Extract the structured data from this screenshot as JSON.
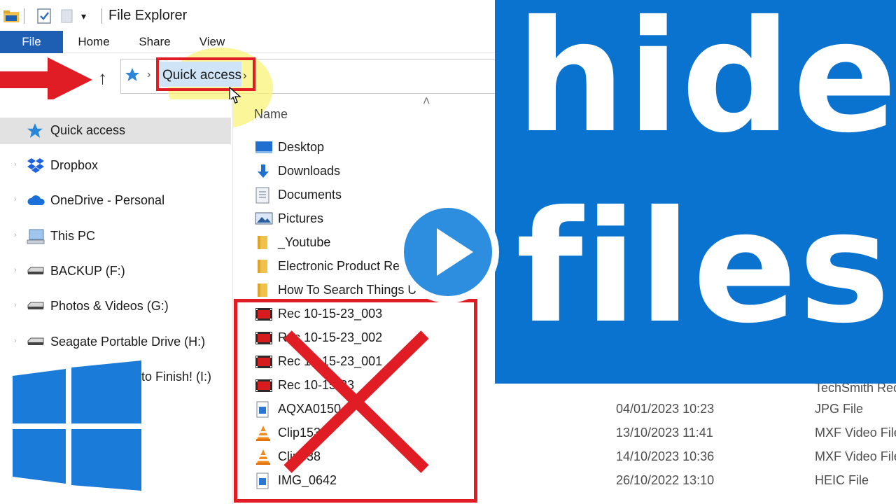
{
  "window": {
    "title": "File Explorer",
    "qat_icons": [
      "folder-icon",
      "properties-icon",
      "new-folder-icon",
      "customize-dropdown-icon"
    ]
  },
  "ribbon": {
    "tabs": [
      {
        "label": "File",
        "active": true
      },
      {
        "label": "Home"
      },
      {
        "label": "Share"
      },
      {
        "label": "View"
      }
    ]
  },
  "address_bar": {
    "breadcrumb": "Quick access",
    "highlight_color": "#e01c24"
  },
  "column_header": {
    "name": "Name"
  },
  "navigation": [
    {
      "label": "Quick access",
      "icon": "star-icon",
      "selected": true
    },
    {
      "label": "Dropbox",
      "icon": "dropbox-icon"
    },
    {
      "label": "OneDrive - Personal",
      "icon": "cloud-icon"
    },
    {
      "label": "This PC",
      "icon": "computer-icon"
    },
    {
      "label": "BACKUP (F:)",
      "icon": "drive-icon"
    },
    {
      "label": "Photos & Videos (G:)",
      "icon": "drive-icon"
    },
    {
      "label": "Seagate Portable Drive (H:)",
      "icon": "drive-icon"
    },
    {
      "label": "to Finish! (I:)",
      "icon": "drive-icon"
    }
  ],
  "files": [
    {
      "name": "Desktop",
      "icon": "desktop-folder-icon",
      "date": "",
      "type": ""
    },
    {
      "name": "Downloads",
      "icon": "downloads-folder-icon",
      "date": "",
      "type": ""
    },
    {
      "name": "Documents",
      "icon": "documents-folder-icon",
      "date": "",
      "type": ""
    },
    {
      "name": "Pictures",
      "icon": "pictures-folder-icon",
      "date": "",
      "type": ""
    },
    {
      "name": "_Youtube",
      "icon": "folder-icon",
      "date": "",
      "type": ""
    },
    {
      "name": "Electronic Product Re",
      "icon": "folder-icon",
      "date": "",
      "type": ""
    },
    {
      "name": "How To Search Things U",
      "icon": "folder-icon",
      "date": "",
      "type": ""
    },
    {
      "name": "Rec 10-15-23_003",
      "icon": "video-file-icon",
      "date": "",
      "type": ""
    },
    {
      "name": "Rec 10-15-23_002",
      "icon": "video-file-icon",
      "date": "",
      "type": ""
    },
    {
      "name": "Rec 10-15-23_001",
      "icon": "video-file-icon",
      "date": "",
      "type": ""
    },
    {
      "name": "Rec 10-15-23",
      "icon": "video-file-icon",
      "date": "",
      "type": ""
    },
    {
      "name": "AQXA0150",
      "icon": "image-file-icon",
      "date": "04/01/2023 10:23",
      "type": "JPG File"
    },
    {
      "name": "Clip153",
      "icon": "vlc-icon",
      "date": "13/10/2023 11:41",
      "type": "MXF Video File"
    },
    {
      "name": "Clip538",
      "icon": "vlc-icon",
      "date": "14/10/2023 10:36",
      "type": "MXF Video File"
    },
    {
      "name": "IMG_0642",
      "icon": "image-file-icon",
      "date": "26/10/2022 13:10",
      "type": "HEIC File"
    }
  ],
  "partial_type_text": "TechSmith Rec",
  "overlay": {
    "headline_line1": "hide",
    "headline_line2": "files",
    "banner_color": "#0a73cf",
    "play_color": "#2d8ddf",
    "accent_red": "#e01c24"
  }
}
